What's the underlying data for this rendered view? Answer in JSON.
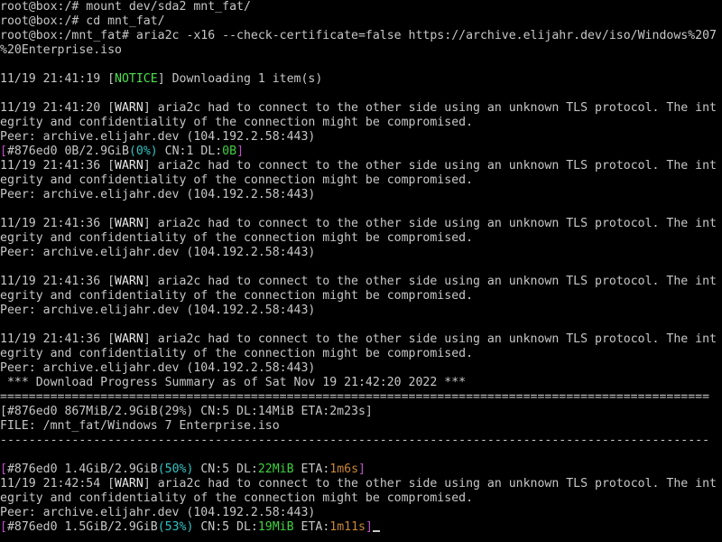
{
  "colors": {
    "background": "#000000",
    "text": "#c7c7c7",
    "notice": "#4be34b",
    "magenta": "#c050c8",
    "cyan": "#31c4c4",
    "green": "#3fd23f",
    "orange": "#c98735"
  },
  "lines": [
    {
      "segments": [
        {
          "text": "root@box:/# mount dev/sda2 mnt_fat/"
        }
      ]
    },
    {
      "segments": [
        {
          "text": "root@box:/# cd mnt_fat/"
        }
      ]
    },
    {
      "segments": [
        {
          "text": "root@box:/mnt_fat# aria2c -x16 --check-certificate=false https://archive.elijahr.dev/iso/Windows%207"
        }
      ]
    },
    {
      "segments": [
        {
          "text": "%20Enterprise.iso"
        }
      ]
    },
    {
      "segments": [
        {
          "text": ""
        }
      ]
    },
    {
      "segments": [
        {
          "text": "11/19 21:41:19 ["
        },
        {
          "text": "NOTICE",
          "cls": "notice"
        },
        {
          "text": "] Downloading 1 item(s)"
        }
      ]
    },
    {
      "segments": [
        {
          "text": ""
        }
      ]
    },
    {
      "segments": [
        {
          "text": "11/19 21:41:20 ["
        },
        {
          "text": "WARN",
          "cls": "warn"
        },
        {
          "text": "] aria2c had to connect to the other side using an unknown TLS protocol. The int"
        }
      ]
    },
    {
      "segments": [
        {
          "text": "egrity and confidentiality of the connection might be compromised."
        }
      ]
    },
    {
      "segments": [
        {
          "text": "Peer: archive.elijahr.dev (104.192.2.58:443)"
        }
      ]
    },
    {
      "segments": [
        {
          "text": "[",
          "cls": "magenta"
        },
        {
          "text": "#876ed0 0B/2.9GiB"
        },
        {
          "text": "(0%)",
          "cls": "cyan"
        },
        {
          "text": " CN:1 DL:"
        },
        {
          "text": "0B",
          "cls": "green"
        },
        {
          "text": "]",
          "cls": "magenta"
        }
      ]
    },
    {
      "segments": [
        {
          "text": "11/19 21:41:36 ["
        },
        {
          "text": "WARN",
          "cls": "warn"
        },
        {
          "text": "] aria2c had to connect to the other side using an unknown TLS protocol. The int"
        }
      ]
    },
    {
      "segments": [
        {
          "text": "egrity and confidentiality of the connection might be compromised."
        }
      ]
    },
    {
      "segments": [
        {
          "text": "Peer: archive.elijahr.dev (104.192.2.58:443)"
        }
      ]
    },
    {
      "segments": [
        {
          "text": ""
        }
      ]
    },
    {
      "segments": [
        {
          "text": "11/19 21:41:36 ["
        },
        {
          "text": "WARN",
          "cls": "warn"
        },
        {
          "text": "] aria2c had to connect to the other side using an unknown TLS protocol. The int"
        }
      ]
    },
    {
      "segments": [
        {
          "text": "egrity and confidentiality of the connection might be compromised."
        }
      ]
    },
    {
      "segments": [
        {
          "text": "Peer: archive.elijahr.dev (104.192.2.58:443)"
        }
      ]
    },
    {
      "segments": [
        {
          "text": ""
        }
      ]
    },
    {
      "segments": [
        {
          "text": "11/19 21:41:36 ["
        },
        {
          "text": "WARN",
          "cls": "warn"
        },
        {
          "text": "] aria2c had to connect to the other side using an unknown TLS protocol. The int"
        }
      ]
    },
    {
      "segments": [
        {
          "text": "egrity and confidentiality of the connection might be compromised."
        }
      ]
    },
    {
      "segments": [
        {
          "text": "Peer: archive.elijahr.dev (104.192.2.58:443)"
        }
      ]
    },
    {
      "segments": [
        {
          "text": ""
        }
      ]
    },
    {
      "segments": [
        {
          "text": "11/19 21:41:36 ["
        },
        {
          "text": "WARN",
          "cls": "warn"
        },
        {
          "text": "] aria2c had to connect to the other side using an unknown TLS protocol. The int"
        }
      ]
    },
    {
      "segments": [
        {
          "text": "egrity and confidentiality of the connection might be compromised."
        }
      ]
    },
    {
      "segments": [
        {
          "text": "Peer: archive.elijahr.dev (104.192.2.58:443)"
        }
      ]
    },
    {
      "segments": [
        {
          "text": " *** Download Progress Summary as of Sat Nov 19 21:42:20 2022 ***"
        }
      ]
    },
    {
      "segments": [
        {
          "text": "==================================================================================================="
        }
      ]
    },
    {
      "segments": [
        {
          "text": "[#876ed0 867MiB/2.9GiB(29%) CN:5 DL:14MiB ETA:2m23s]"
        }
      ]
    },
    {
      "segments": [
        {
          "text": "FILE: /mnt_fat/Windows 7 Enterprise.iso"
        }
      ]
    },
    {
      "segments": [
        {
          "text": "---------------------------------------------------------------------------------------------------"
        }
      ]
    },
    {
      "segments": [
        {
          "text": ""
        }
      ]
    },
    {
      "segments": [
        {
          "text": "[",
          "cls": "magenta"
        },
        {
          "text": "#876ed0 1.4GiB/2.9GiB"
        },
        {
          "text": "(50%)",
          "cls": "cyan"
        },
        {
          "text": " CN:5 DL:"
        },
        {
          "text": "22MiB",
          "cls": "green"
        },
        {
          "text": " ETA:"
        },
        {
          "text": "1m6s",
          "cls": "orange"
        },
        {
          "text": "]",
          "cls": "magenta"
        }
      ]
    },
    {
      "segments": [
        {
          "text": "11/19 21:42:54 ["
        },
        {
          "text": "WARN",
          "cls": "warn"
        },
        {
          "text": "] aria2c had to connect to the other side using an unknown TLS protocol. The int"
        }
      ]
    },
    {
      "segments": [
        {
          "text": "egrity and confidentiality of the connection might be compromised."
        }
      ]
    },
    {
      "segments": [
        {
          "text": "Peer: archive.elijahr.dev (104.192.2.58:443)"
        }
      ]
    },
    {
      "segments": [
        {
          "text": "[",
          "cls": "magenta"
        },
        {
          "text": "#876ed0 1.5GiB/2.9GiB"
        },
        {
          "text": "(53%)",
          "cls": "cyan"
        },
        {
          "text": " CN:5 DL:"
        },
        {
          "text": "19MiB",
          "cls": "green"
        },
        {
          "text": " ETA:"
        },
        {
          "text": "1m11s",
          "cls": "orange"
        },
        {
          "text": "]",
          "cls": "magenta"
        }
      ],
      "cursor": true
    }
  ]
}
